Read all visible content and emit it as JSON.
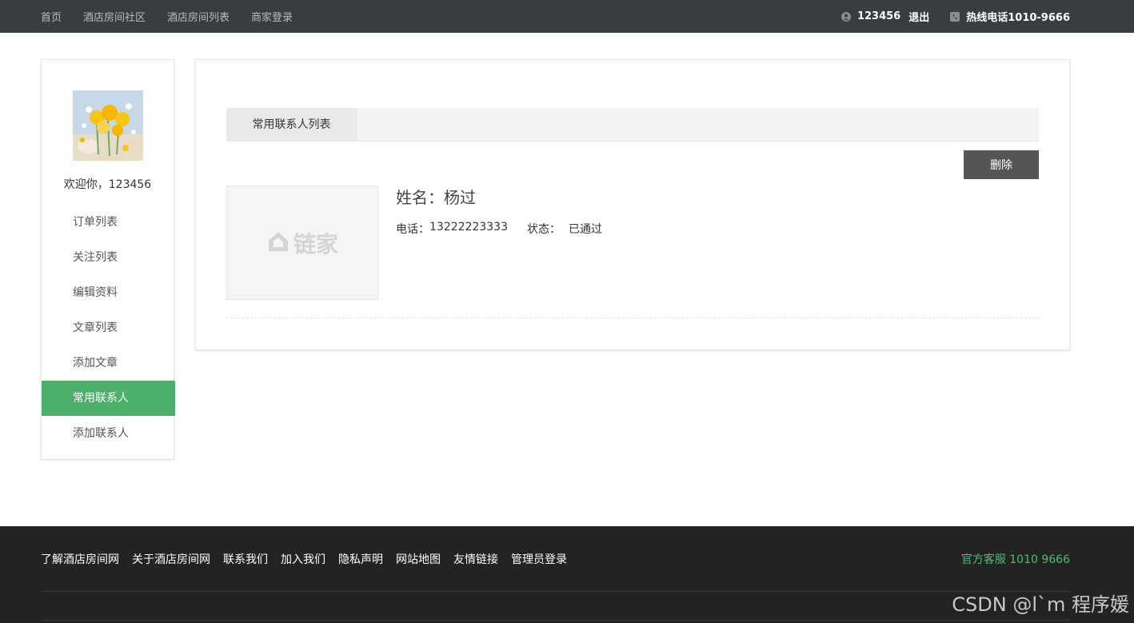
{
  "topbar": {
    "nav": [
      "首页",
      "酒店房间社区",
      "酒店房间列表",
      "商家登录"
    ],
    "username": "123456",
    "logout": "退出",
    "hotline": "热线电话1010-9666"
  },
  "sidebar": {
    "welcome": "欢迎你，123456",
    "menu": [
      "订单列表",
      "关注列表",
      "编辑资料",
      "文章列表",
      "添加文章",
      "常用联系人",
      "添加联系人"
    ],
    "active_index": 5,
    "accent_color": "#4caf6a"
  },
  "main": {
    "tab_label": "常用联系人列表",
    "delete_label": "删除",
    "contact": {
      "thumb_logo": "链家",
      "name": "姓名：杨过",
      "phone_label": "电话：",
      "phone": "13222223333",
      "status_label": "状态：",
      "status": "已通过"
    }
  },
  "footer": {
    "links": [
      "了解酒店房间网",
      "关于酒店房间网",
      "联系我们",
      "加入我们",
      "隐私声明",
      "网站地图",
      "友情链接",
      "管理员登录"
    ],
    "service": "官方客服 1010 9666",
    "watermark": "CSDN @l`m 程序媛"
  }
}
